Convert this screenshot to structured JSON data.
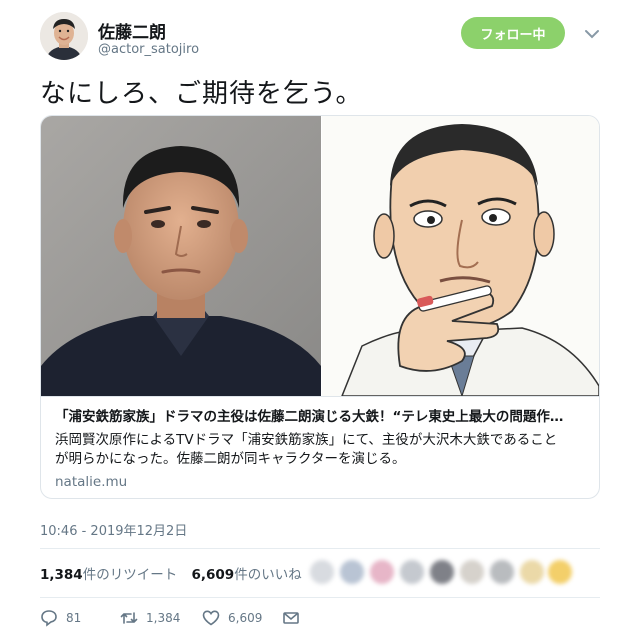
{
  "profile": {
    "display_name": "佐藤二朗",
    "handle": "@actor_satojiro",
    "follow_label": "フォロー中"
  },
  "tweet": {
    "text": "なにしろ、ご期待を乞う。",
    "timestamp": "10:46 - 2019年12月2日"
  },
  "card": {
    "title": "「浦安鉄筋家族」ドラマの主役は佐藤二朗演じる大鉄！“テレ東史上最大の問題作…",
    "description_line1": "浜岡賢次原作によるTVドラマ「浦安鉄筋家族」にて、主役が大沢木大鉄であること",
    "description_line2": "が明らかになった。佐藤二朗が同キャラクターを演じる。",
    "domain": "natalie.mu"
  },
  "stats": {
    "retweets": "1,384",
    "retweets_label": "件のリツイート",
    "likes": "6,609",
    "likes_label": "件のいいね"
  },
  "actions": {
    "reply_count": "81",
    "retweet_count": "1,384",
    "like_count": "6,609"
  },
  "colors": {
    "follow_button": "#8cd16b",
    "muted_text": "#657786",
    "border": "#dfe5ea"
  }
}
